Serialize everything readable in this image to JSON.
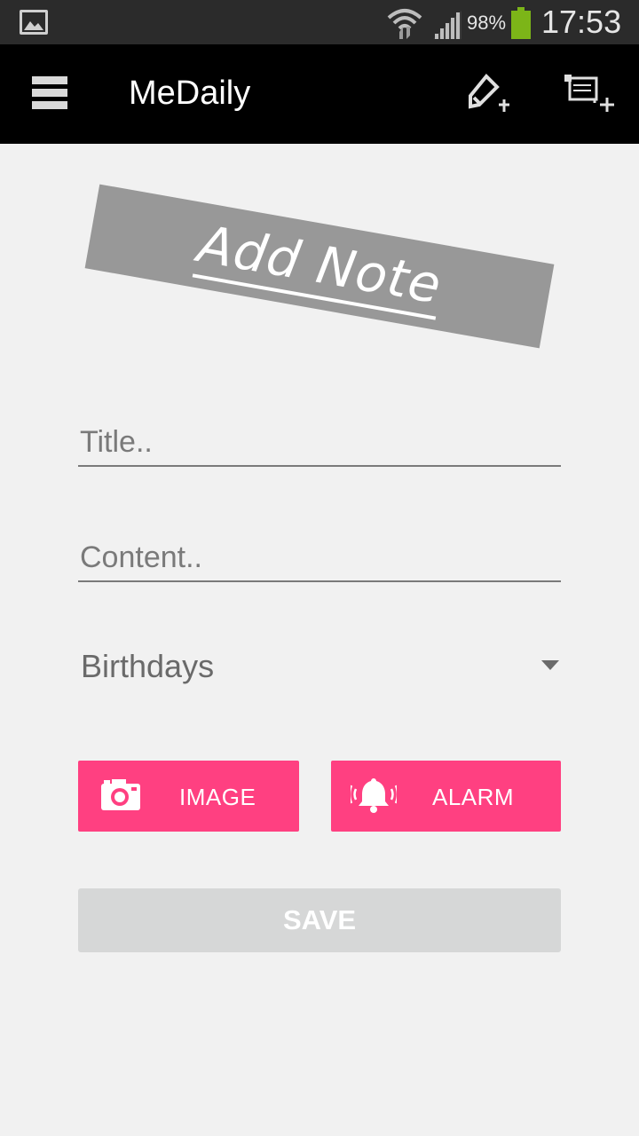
{
  "status_bar": {
    "battery_percent": "98%",
    "time": "17:53",
    "icons": [
      "gallery-icon",
      "wifi-icon",
      "signal-icon",
      "battery-icon"
    ],
    "battery_color": "#7cb518"
  },
  "action_bar": {
    "title": "MeDaily",
    "icons": [
      "drawer-menu-icon",
      "edit-add-icon",
      "note-add-icon"
    ]
  },
  "banner": {
    "text": "Add Note"
  },
  "form": {
    "title_placeholder": "Title..",
    "title_value": "",
    "content_placeholder": "Content..",
    "content_value": "",
    "category_selected": "Birthdays"
  },
  "buttons": {
    "image_label": "IMAGE",
    "alarm_label": "ALARM",
    "save_label": "SAVE"
  },
  "colors": {
    "accent": "#ff4081",
    "action_bar": "#000000",
    "background": "#f1f1f1",
    "save_disabled": "#d6d7d7"
  }
}
